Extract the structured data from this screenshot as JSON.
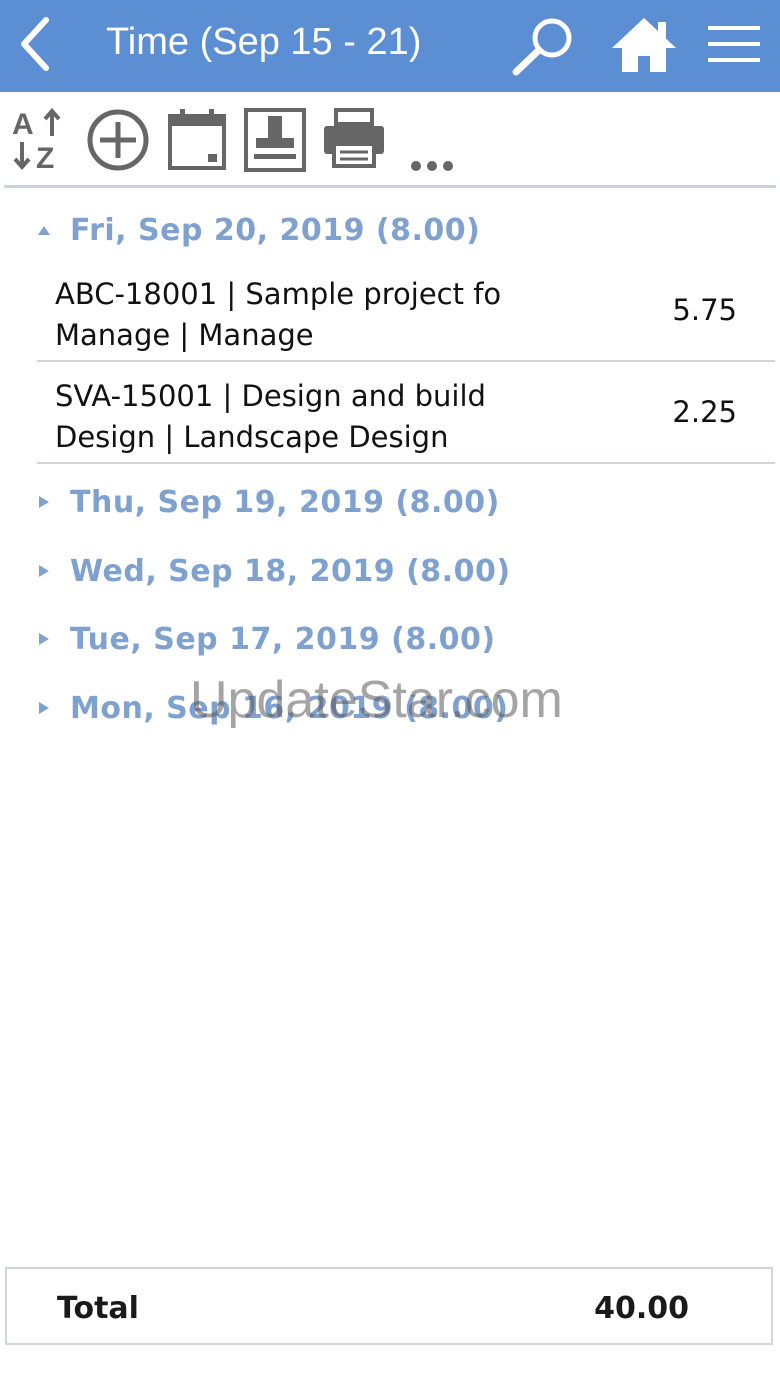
{
  "header": {
    "title": "Time (Sep 15 - 21)",
    "back_icon": "chevron-left-icon",
    "search_icon": "search-icon",
    "home_icon": "home-icon",
    "menu_icon": "hamburger-menu-icon",
    "color": "#5b8ed3"
  },
  "toolbar": {
    "items": [
      "sort-az-icon",
      "add-circle-icon",
      "calendar-icon",
      "stamp-icon",
      "print-icon",
      "more-icon"
    ],
    "more_label": "..."
  },
  "days": [
    {
      "label": "Fri, Sep 20, 2019 (8.00)",
      "expanded": true,
      "entries": [
        {
          "line1": "ABC-18001 | Sample project fo",
          "line2": "Manage | Manage",
          "hours": "5.75"
        },
        {
          "line1": "SVA-15001 | Design and build",
          "line2": "Design | Landscape Design",
          "hours": "2.25"
        }
      ]
    },
    {
      "label": "Thu, Sep 19, 2019 (8.00)",
      "expanded": false
    },
    {
      "label": "Wed, Sep 18, 2019 (8.00)",
      "expanded": false
    },
    {
      "label": "Tue, Sep 17, 2019 (8.00)",
      "expanded": false
    },
    {
      "label": "Mon, Sep 16, 2019 (8.00)",
      "expanded": false
    }
  ],
  "watermark": "UpdateStar.com",
  "footer": {
    "total_label": "Total",
    "total_value": "40.00"
  },
  "colors": {
    "header_bg": "#5b8ed3",
    "day_label": "#7fa1cf",
    "icon_gray": "#666666"
  }
}
